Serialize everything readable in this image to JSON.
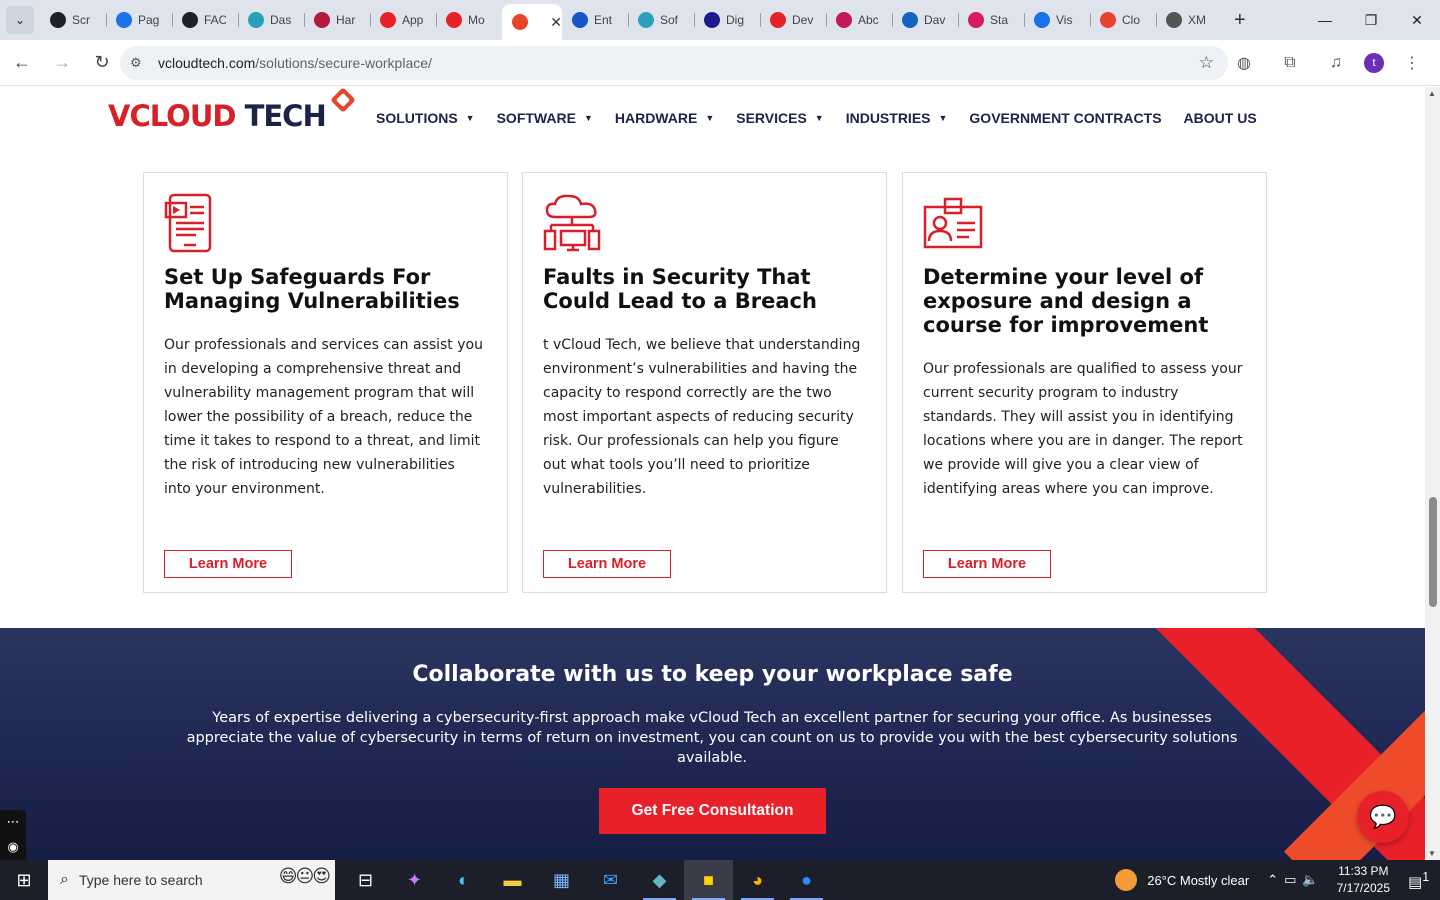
{
  "browser": {
    "tabs": [
      {
        "title": "Scr",
        "color": "#202124"
      },
      {
        "title": "Pag",
        "color": "#1a73e8"
      },
      {
        "title": "FAC",
        "color": "#202124"
      },
      {
        "title": "Das",
        "color": "#2aa1b9"
      },
      {
        "title": "Har",
        "color": "#b31b3d"
      },
      {
        "title": "App",
        "color": "#e8202a"
      },
      {
        "title": "Mo",
        "color": "#e8202a"
      },
      {
        "title": "",
        "color": "#e8432b",
        "active": true
      },
      {
        "title": "Ent",
        "color": "#1a56c8"
      },
      {
        "title": "Sof",
        "color": "#2aa1b9"
      },
      {
        "title": "Dig",
        "color": "#1a1a8a"
      },
      {
        "title": "Dev",
        "color": "#e8202a"
      },
      {
        "title": "Abc",
        "color": "#c2185b"
      },
      {
        "title": "Dav",
        "color": "#1565c0"
      },
      {
        "title": "Sta",
        "color": "#d81b60"
      },
      {
        "title": "Vis",
        "color": "#1a73e8"
      },
      {
        "title": "Clo",
        "color": "#e8432b"
      },
      {
        "title": "XM",
        "color": "#555555"
      }
    ],
    "url_host": "vcloudtech.com",
    "url_path": "/solutions/secure-workplace/",
    "avatar_letter": "t"
  },
  "site": {
    "logo": {
      "v": "V",
      "rest": "CLOUD",
      "tech": "TECH"
    },
    "nav": [
      {
        "label": "SOLUTIONS",
        "dropdown": true
      },
      {
        "label": "SOFTWARE",
        "dropdown": true
      },
      {
        "label": "HARDWARE",
        "dropdown": true
      },
      {
        "label": "SERVICES",
        "dropdown": true
      },
      {
        "label": "INDUSTRIES",
        "dropdown": true
      },
      {
        "label": "GOVERNMENT CONTRACTS",
        "dropdown": false
      },
      {
        "label": "ABOUT US",
        "dropdown": false
      }
    ],
    "cards": [
      {
        "title": "Set Up Safeguards For Managing Vulnerabilities",
        "body": "Our professionals and services can assist you in developing a comprehensive threat and vulnerability management program that will lower the possibility of a breach, reduce the time it takes to respond to a threat, and limit the risk of introducing new vulnerabilities into your environment.",
        "button": "Learn More"
      },
      {
        "title": "Faults in Security That Could Lead to a Breach",
        "body": "t vCloud Tech, we believe that understanding environment’s vulnerabilities and having the capacity to respond correctly are the two most important aspects of reducing security risk. Our professionals can help you figure out what tools you’ll need to prioritize vulnerabilities.",
        "button": "Learn More"
      },
      {
        "title": "Determine your level of exposure and design a course for improvement",
        "body": "Our professionals are qualified to assess your current security program to industry standards. They will assist you in identifying locations where you are in danger. The report we provide will give you a clear view of identifying areas where you can improve.",
        "button": "Learn More"
      }
    ],
    "cta": {
      "title": "Collaborate with us to keep your workplace safe",
      "body": "Years of expertise delivering a cybersecurity-first approach make vCloud Tech an excellent partner for securing your office. As businesses appreciate the value of cybersecurity in terms of return on investment, you can count on us to provide you with the best cybersecurity solutions available.",
      "button": "Get Free Consultation"
    },
    "colors": {
      "brand_red": "#d7202a",
      "navy": "#1c2347"
    }
  },
  "taskbar": {
    "search_placeholder": "Type here to search",
    "weather": "26°C  Mostly clear",
    "time": "11:33 PM",
    "date": "7/17/2025",
    "notifications": "1"
  }
}
